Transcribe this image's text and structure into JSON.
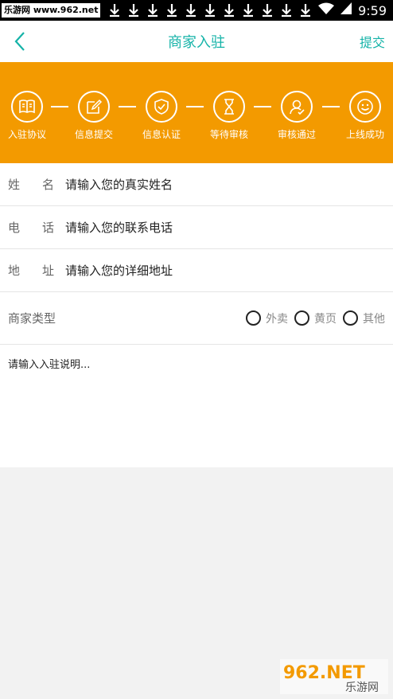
{
  "status_bar": {
    "brand": "乐游网 www.962.net",
    "time": "9:59",
    "icons": [
      "download-icon",
      "download-icon",
      "download-icon",
      "download-icon",
      "download-icon",
      "download-icon",
      "download-icon",
      "download-icon",
      "download-icon",
      "download-icon",
      "download-icon",
      "wifi-icon",
      "signal-icon"
    ]
  },
  "header": {
    "title": "商家入驻",
    "submit_label": "提交",
    "accent": "#15b3a8"
  },
  "steps": {
    "background": "#f39a00",
    "items": [
      {
        "label": "入驻协议",
        "icon": "book-icon"
      },
      {
        "label": "信息提交",
        "icon": "edit-icon"
      },
      {
        "label": "信息认证",
        "icon": "shield-check-icon"
      },
      {
        "label": "等待审核",
        "icon": "hourglass-icon"
      },
      {
        "label": "审核通过",
        "icon": "user-check-icon"
      },
      {
        "label": "上线成功",
        "icon": "smile-icon"
      }
    ]
  },
  "form": {
    "name": {
      "label_a": "姓",
      "label_b": "名",
      "placeholder": "请输入您的真实姓名"
    },
    "phone": {
      "label_a": "电",
      "label_b": "话",
      "placeholder": "请输入您的联系电话"
    },
    "address": {
      "label_a": "地",
      "label_b": "址",
      "placeholder": "请输入您的详细地址"
    },
    "type": {
      "label": "商家类型",
      "options": [
        "外卖",
        "黄页",
        "其他"
      ]
    },
    "description_placeholder": "请输入入驻说明..."
  },
  "watermark": {
    "text_top": "962.NET",
    "text_bottom": "乐游网"
  }
}
